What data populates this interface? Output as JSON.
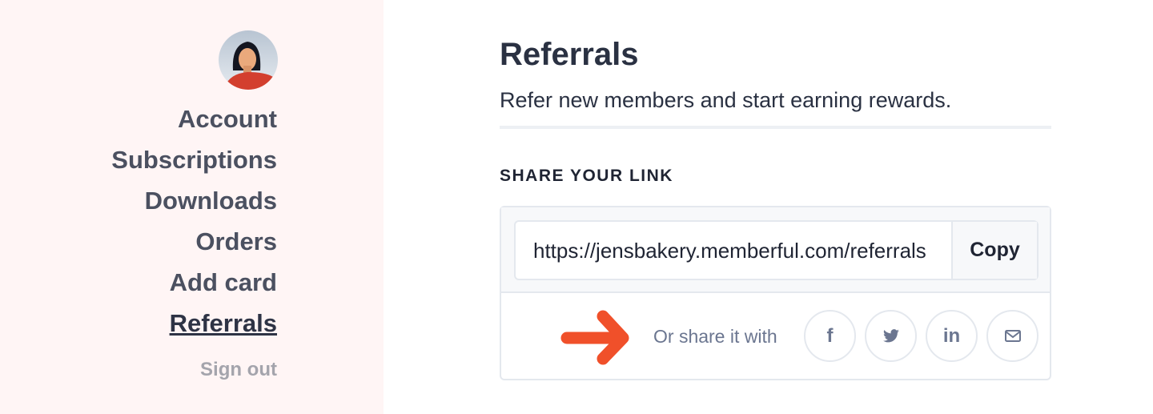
{
  "sidebar": {
    "items": [
      {
        "label": "Account"
      },
      {
        "label": "Subscriptions"
      },
      {
        "label": "Downloads"
      },
      {
        "label": "Orders"
      },
      {
        "label": "Add card"
      },
      {
        "label": "Referrals",
        "active": true
      }
    ],
    "sign_out": "Sign out"
  },
  "main": {
    "title": "Referrals",
    "subtitle": "Refer new members and start earning rewards.",
    "section_label": "SHARE YOUR LINK",
    "link_value": "https://jensbakery.memberful.com/referrals",
    "copy_label": "Copy",
    "share_text": "Or share it with",
    "share_icons": [
      "facebook-icon",
      "twitter-icon",
      "linkedin-icon",
      "email-icon"
    ]
  },
  "colors": {
    "sidebar_bg": "#fff5f5",
    "accent_arrow": "#f0502a",
    "text": "#2a3142"
  }
}
